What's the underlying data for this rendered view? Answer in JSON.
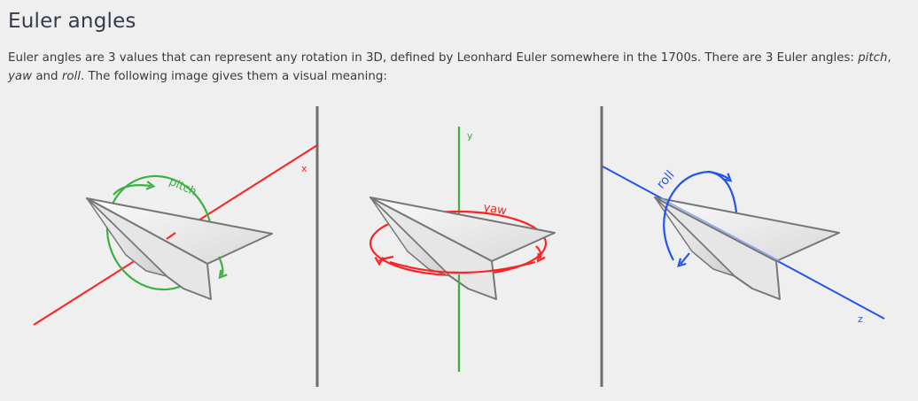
{
  "section": {
    "title": "Euler angles"
  },
  "intro": {
    "part1": "Euler angles are 3 values that can represent any rotation in 3D, defined by Leonhard Euler somewhere in the 1700s. There are 3 Euler angles: ",
    "pitch": "pitch",
    "sep1": ", ",
    "yaw": "yaw",
    "sep2": " and ",
    "roll": "roll",
    "part2": ". The following image gives them a visual meaning:"
  },
  "figure": {
    "panels": [
      {
        "angle_label": "pitch",
        "axis_label": "x",
        "color": "#3cb043",
        "axis_color": "#ff2020"
      },
      {
        "angle_label": "yaw",
        "axis_label": "y",
        "color": "#ff2020",
        "axis_color": "#3cb043"
      },
      {
        "angle_label": "roll",
        "axis_label": "z",
        "color": "#2255ee",
        "axis_color": "#2255ee"
      }
    ],
    "divider_color": "#6e6e6e"
  }
}
